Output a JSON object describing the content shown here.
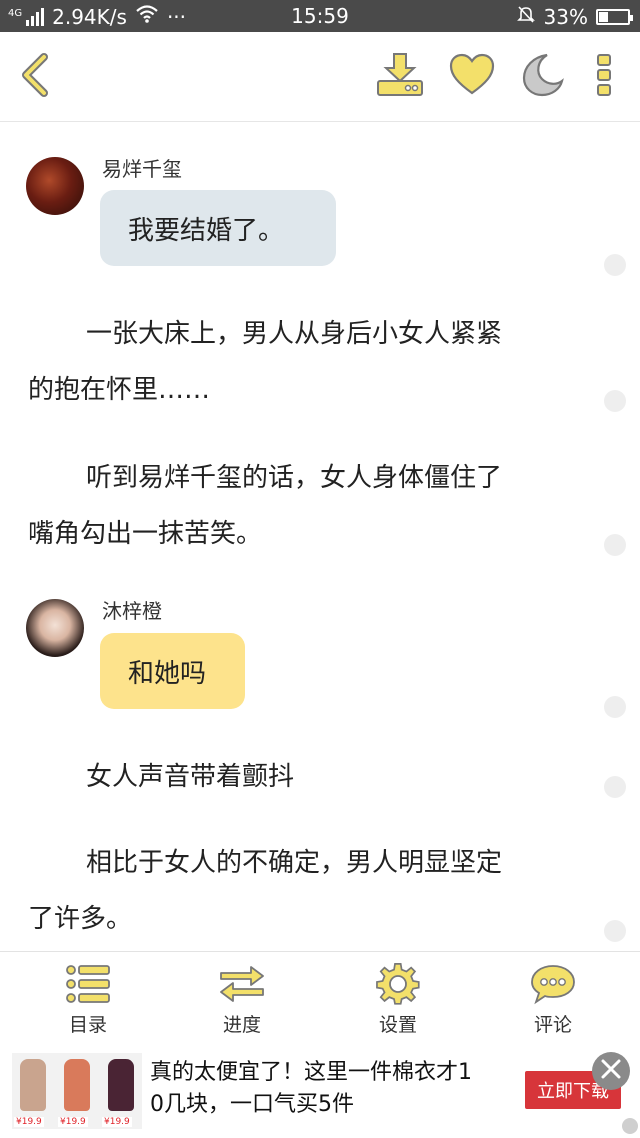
{
  "status_bar": {
    "network_type": "4G",
    "speed": "2.94K/s",
    "dots": "···",
    "time": "15:59",
    "battery": "33%",
    "battery_level": 0.33
  },
  "toolbar": {
    "accent_color": "#f3e06a",
    "icon_stroke": "#777777",
    "icons": [
      "back-icon",
      "download-icon",
      "heart-icon",
      "moon-icon",
      "more-icon"
    ]
  },
  "story": {
    "msg1": {
      "speaker": "易烊千玺",
      "text": "我要结婚了。"
    },
    "para1": [
      "一张大床上，男人从身后小女人紧紧",
      "的抱在怀里……"
    ],
    "para2": [
      "听到易烊千玺的话，女人身体僵住了",
      "嘴角勾出一抹苦笑。"
    ],
    "msg2": {
      "speaker": "沐梓橙",
      "text": "和她吗"
    },
    "para3": [
      "女人声音带着颤抖"
    ],
    "para4": [
      "相比于女人的不确定，男人明显坚定",
      "了许多。"
    ]
  },
  "bottom_nav": {
    "catalog": "目录",
    "progress": "进度",
    "settings": "设置",
    "comment": "评论"
  },
  "ad": {
    "text": [
      "真的太便宜了！这里一件棉衣才1",
      "0几块，一口气买5件"
    ],
    "cta": "立即下载",
    "prices": [
      "¥19.9",
      "¥19.9",
      "¥19.9"
    ]
  }
}
